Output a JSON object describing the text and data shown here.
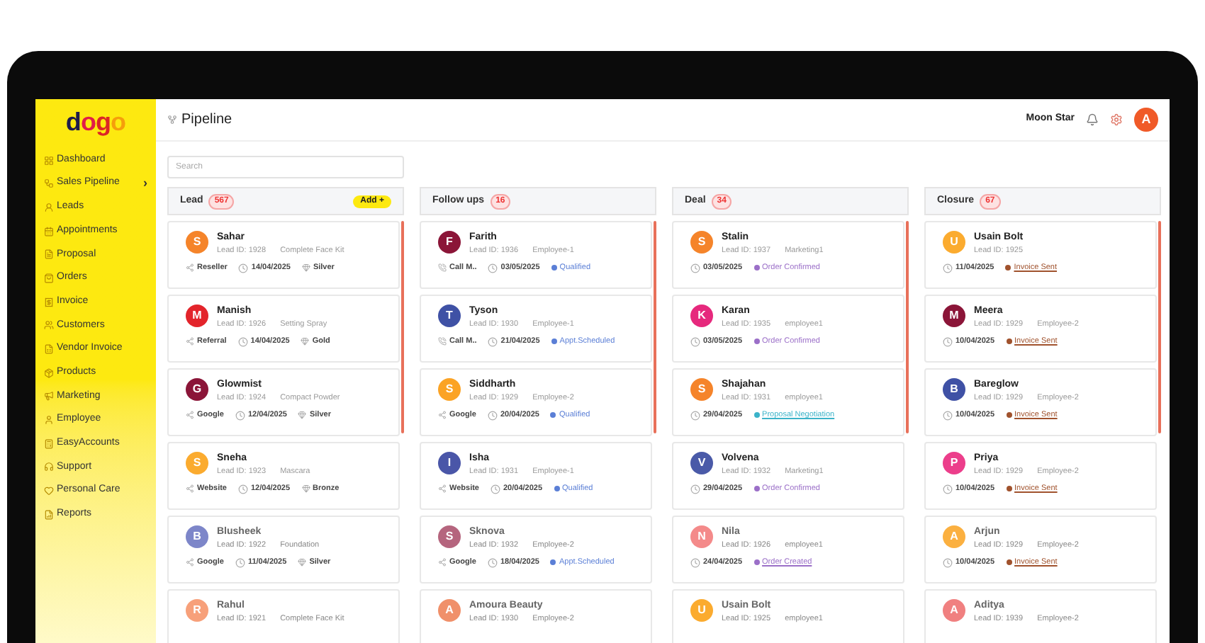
{
  "logo": "dogo",
  "sidebar": {
    "items": [
      {
        "label": "Dashboard",
        "kind": "grid"
      },
      {
        "label": "Sales Pipeline",
        "kind": "pipeline",
        "chevron": "›"
      },
      {
        "label": "Leads",
        "kind": "leads"
      },
      {
        "label": "Appointments",
        "kind": "calendar"
      },
      {
        "label": "Proposal",
        "kind": "file"
      },
      {
        "label": "Orders",
        "kind": "bag"
      },
      {
        "label": "Invoice",
        "kind": "receipt"
      },
      {
        "label": "Customers",
        "kind": "users"
      },
      {
        "label": "Vendor Invoice",
        "kind": "sheet"
      },
      {
        "label": "Products",
        "kind": "package"
      },
      {
        "label": "Marketing",
        "kind": "megaphone"
      },
      {
        "label": "Employee",
        "kind": "user"
      },
      {
        "label": "EasyAccounts",
        "kind": "calc"
      },
      {
        "label": "Support",
        "kind": "headset"
      },
      {
        "label": "Personal Care",
        "kind": "heart"
      },
      {
        "label": "Reports",
        "kind": "report"
      }
    ]
  },
  "header": {
    "title": "Pipeline",
    "user": "Moon Star",
    "avatar": "A"
  },
  "search": {
    "placeholder": "Search"
  },
  "columns": [
    {
      "title": "Lead",
      "count": "567",
      "add_button": "Add +",
      "cards": [
        {
          "initial": "S",
          "name": "Sahar",
          "color": "#f5842a",
          "lead_id": "Lead ID: 1928",
          "detail": "Complete Face Kit",
          "source": {
            "text": "Reseller",
            "kind": "web"
          },
          "date": "14/04/2025",
          "tier": "Silver"
        },
        {
          "initial": "M",
          "name": "Manish",
          "color": "#e3242b",
          "lead_id": "Lead ID: 1926",
          "detail": "Setting Spray",
          "source": {
            "text": "Referral",
            "kind": "web"
          },
          "date": "14/04/2025",
          "tier": "Gold"
        },
        {
          "initial": "G",
          "name": "Glowmist",
          "color": "#8b1538",
          "lead_id": "Lead ID: 1924",
          "detail": "Compact Powder",
          "source": {
            "text": "Google",
            "kind": "web"
          },
          "date": "12/04/2025",
          "tier": "Silver"
        },
        {
          "initial": "S",
          "name": "Sneha",
          "color": "#fbab2f",
          "lead_id": "Lead ID: 1923",
          "detail": "Mascara",
          "source": {
            "text": "Website",
            "kind": "web"
          },
          "date": "12/04/2025",
          "tier": "Bronze"
        },
        {
          "initial": "B",
          "name": "Blusheek",
          "color": "#7d86c9",
          "lead_id": "Lead ID: 1922",
          "detail": "Foundation",
          "source": {
            "text": "Google",
            "kind": "web"
          },
          "date": "11/04/2025",
          "tier": "Silver"
        },
        {
          "initial": "R",
          "name": "Rahul",
          "color": "#f7a07a",
          "lead_id": "Lead ID: 1921",
          "detail": "Complete Face Kit"
        }
      ]
    },
    {
      "title": "Follow ups",
      "count": "16",
      "cards": [
        {
          "initial": "F",
          "name": "Farith",
          "color": "#8b1538",
          "lead_id": "Lead ID: 1936",
          "detail": "Employee-1",
          "source": {
            "text": "Call M..",
            "kind": "call"
          },
          "date": "03/05/2025",
          "status": {
            "text": "Qualified",
            "color": "#5b7fd6",
            "underlined": false
          }
        },
        {
          "initial": "T",
          "name": "Tyson",
          "color": "#3f51a5",
          "lead_id": "Lead ID: 1930",
          "detail": "Employee-1",
          "source": {
            "text": "Call M..",
            "kind": "call"
          },
          "date": "21/04/2025",
          "status": {
            "text": "Appt.Scheduled",
            "color": "#5b7fd6",
            "underlined": false
          }
        },
        {
          "initial": "S",
          "name": "Siddharth",
          "color": "#fba325",
          "lead_id": "Lead ID: 1929",
          "detail": "Employee-2",
          "source": {
            "text": "Google",
            "kind": "web"
          },
          "date": "20/04/2025",
          "status": {
            "text": "Qualified",
            "color": "#5b7fd6",
            "underlined": false
          }
        },
        {
          "initial": "I",
          "name": "Isha",
          "color": "#4a56a8",
          "lead_id": "Lead ID: 1931",
          "detail": "Employee-1",
          "source": {
            "text": "Website",
            "kind": "web"
          },
          "date": "20/04/2025",
          "status": {
            "text": "Qualified",
            "color": "#5b7fd6",
            "underlined": false
          }
        },
        {
          "initial": "S",
          "name": "Sknova",
          "color": "#b5657e",
          "lead_id": "Lead ID: 1932",
          "detail": "Employee-2",
          "source": {
            "text": "Google",
            "kind": "web"
          },
          "date": "18/04/2025",
          "status": {
            "text": "Appt.Scheduled",
            "color": "#5b7fd6",
            "underlined": false
          }
        },
        {
          "initial": "A",
          "name": "Amoura Beauty",
          "color": "#f0906a",
          "lead_id": "Lead ID: 1930",
          "detail": "Employee-2"
        }
      ]
    },
    {
      "title": "Deal",
      "count": "34",
      "cards": [
        {
          "initial": "S",
          "name": "Stalin",
          "color": "#f5842a",
          "lead_id": "Lead ID: 1937",
          "detail": "Marketing1",
          "date": "03/05/2025",
          "status": {
            "text": "Order Confirmed",
            "color": "#9b6fc8",
            "underlined": false
          }
        },
        {
          "initial": "K",
          "name": "Karan",
          "color": "#e6297d",
          "lead_id": "Lead ID: 1935",
          "detail": "employee1",
          "date": "03/05/2025",
          "status": {
            "text": "Order Confirmed",
            "color": "#9b6fc8",
            "underlined": false
          }
        },
        {
          "initial": "S",
          "name": "Shajahan",
          "color": "#f5842a",
          "lead_id": "Lead ID: 1931",
          "detail": "employee1",
          "date": "29/04/2025",
          "status": {
            "text": "Proposal Negotiation",
            "color": "#3bb3c9",
            "underlined": true
          }
        },
        {
          "initial": "V",
          "name": "Volvena",
          "color": "#4a5aa8",
          "lead_id": "Lead ID: 1932",
          "detail": "Marketing1",
          "date": "29/04/2025",
          "status": {
            "text": "Order Confirmed",
            "color": "#9b6fc8",
            "underlined": false
          }
        },
        {
          "initial": "N",
          "name": "Nila",
          "color": "#f48a8a",
          "lead_id": "Lead ID: 1926",
          "detail": "employee1",
          "date": "24/04/2025",
          "status": {
            "text": "Order Created",
            "color": "#9b6fc8",
            "underlined": true
          }
        },
        {
          "initial": "U",
          "name": "Usain Bolt",
          "color": "#fbab2f",
          "lead_id": "Lead ID: 1925",
          "detail": "employee1"
        }
      ]
    },
    {
      "title": "Closure",
      "count": "67",
      "cards": [
        {
          "initial": "U",
          "name": "Usain Bolt",
          "color": "#fbab2f",
          "lead_id": "Lead ID: 1925",
          "date": "11/04/2025",
          "status": {
            "text": "Invoice Sent",
            "color": "#a0522d",
            "underlined": true
          }
        },
        {
          "initial": "M",
          "name": "Meera",
          "color": "#8b1538",
          "lead_id": "Lead ID: 1929",
          "detail": "Employee-2",
          "date": "10/04/2025",
          "status": {
            "text": "Invoice Sent",
            "color": "#a0522d",
            "underlined": true
          }
        },
        {
          "initial": "B",
          "name": "Bareglow",
          "color": "#3f51a5",
          "lead_id": "Lead ID: 1929",
          "detail": "Employee-2",
          "date": "10/04/2025",
          "status": {
            "text": "Invoice Sent",
            "color": "#a0522d",
            "underlined": true
          }
        },
        {
          "initial": "P",
          "name": "Priya",
          "color": "#ec3e8b",
          "lead_id": "Lead ID: 1929",
          "detail": "Employee-2",
          "date": "10/04/2025",
          "status": {
            "text": "Invoice Sent",
            "color": "#a0522d",
            "underlined": true
          }
        },
        {
          "initial": "A",
          "name": "Arjun",
          "color": "#fbb040",
          "lead_id": "Lead ID: 1929",
          "detail": "Employee-2",
          "date": "10/04/2025",
          "status": {
            "text": "Invoice Sent",
            "color": "#a0522d",
            "underlined": true
          }
        },
        {
          "initial": "A",
          "name": "Aditya",
          "color": "#f08080",
          "lead_id": "Lead ID: 1939",
          "detail": "Employee-2"
        }
      ]
    }
  ]
}
